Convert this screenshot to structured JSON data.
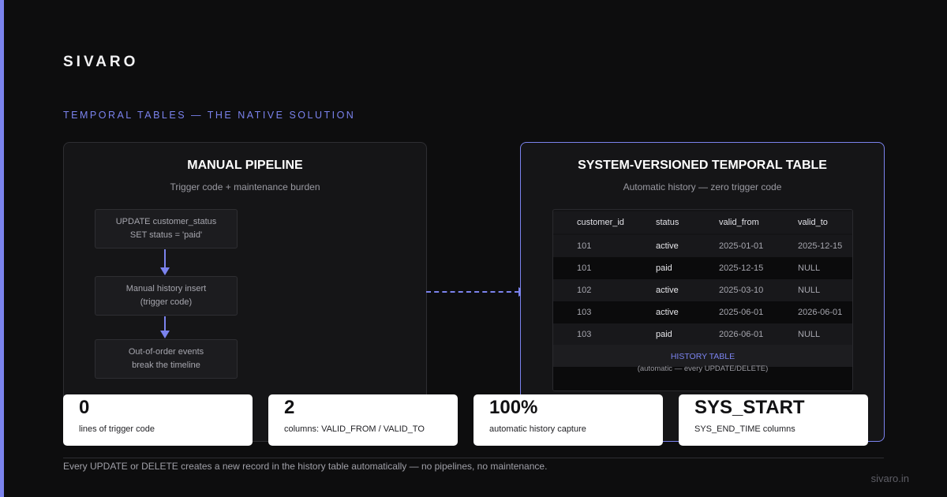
{
  "brand": "SIVARO",
  "subtitle": "TEMPORAL TABLES — THE NATIVE SOLUTION",
  "left_panel": {
    "title": "MANUAL PIPELINE",
    "subtitle": "Trigger code + maintenance burden",
    "steps": [
      {
        "line1": "UPDATE customer_status",
        "line2": "SET status = 'paid'"
      },
      {
        "line1": "Manual history insert",
        "line2": "(trigger code)"
      },
      {
        "line1": "Out-of-order events",
        "line2": "break the timeline"
      }
    ]
  },
  "right_panel": {
    "title": "SYSTEM-VERSIONED TEMPORAL TABLE",
    "subtitle": "Automatic history — zero trigger code",
    "table": {
      "headers": [
        "customer_id",
        "status",
        "valid_from",
        "valid_to"
      ],
      "rows": [
        [
          "101",
          "active",
          "2025-01-01",
          "2025-12-15"
        ],
        [
          "101",
          "paid",
          "2025-12-15",
          "NULL"
        ],
        [
          "102",
          "active",
          "2025-03-10",
          "NULL"
        ],
        [
          "103",
          "active",
          "2025-06-01",
          "2026-06-01"
        ],
        [
          "103",
          "paid",
          "2026-06-01",
          "NULL"
        ]
      ]
    },
    "history_label": "HISTORY TABLE",
    "history_note": "(automatic — every UPDATE/DELETE)"
  },
  "stats": [
    {
      "value": "0",
      "label": "lines of trigger code"
    },
    {
      "value": "2",
      "label": "columns: VALID_FROM / VALID_TO"
    },
    {
      "value": "100%",
      "label": "automatic history capture"
    },
    {
      "value": "SYS_START",
      "label": "SYS_END_TIME columns"
    }
  ],
  "footnote": "Every UPDATE or DELETE creates a new record in the history table automatically — no pipelines, no maintenance.",
  "site": "sivaro.in",
  "colors": {
    "accent": "#7b83ee",
    "background": "#0d0d0e",
    "card": "#ffffff"
  }
}
